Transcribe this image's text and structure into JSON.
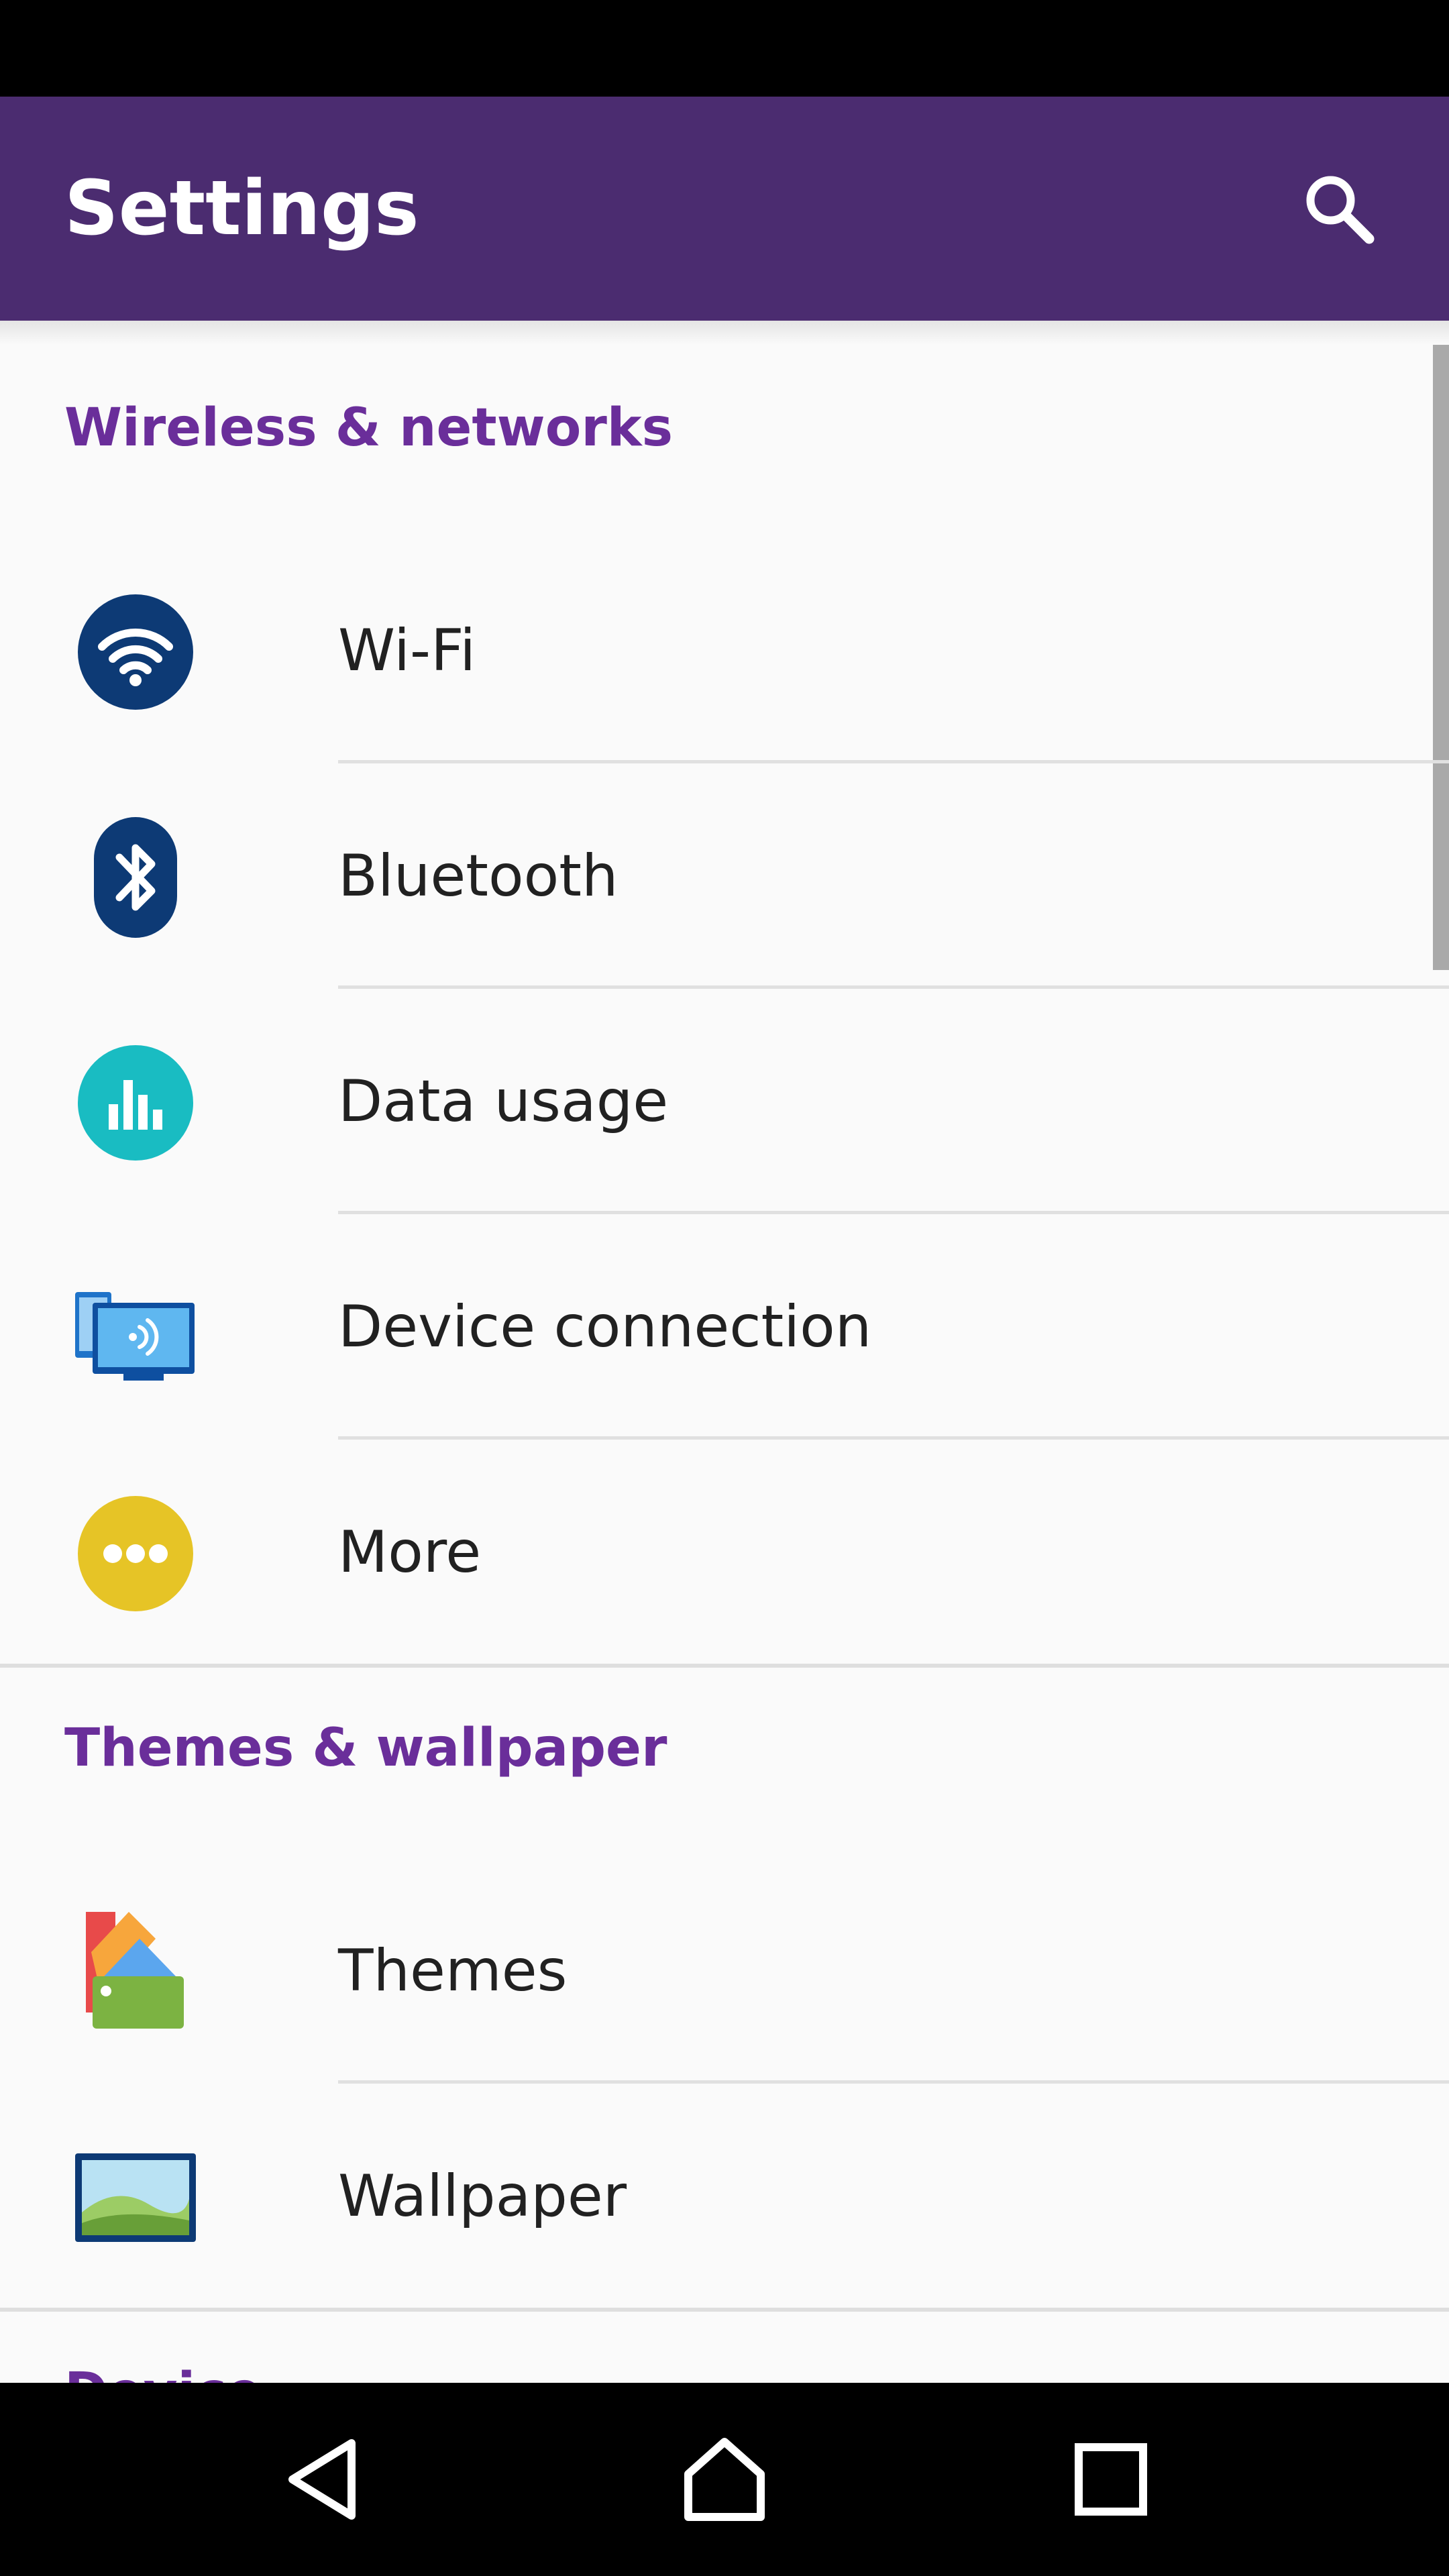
{
  "app_bar": {
    "title": "Settings",
    "search_icon": "search-icon",
    "background": "#4b2c70"
  },
  "accent_color": "#6a2e9a",
  "sections": [
    {
      "header": "Wireless & networks",
      "items": [
        {
          "label": "Wi-Fi",
          "icon": "wifi-icon"
        },
        {
          "label": "Bluetooth",
          "icon": "bluetooth-icon"
        },
        {
          "label": "Data usage",
          "icon": "data-usage-icon"
        },
        {
          "label": "Device connection",
          "icon": "device-connection-icon"
        },
        {
          "label": "More",
          "icon": "more-icon"
        }
      ]
    },
    {
      "header": "Themes & wallpaper",
      "items": [
        {
          "label": "Themes",
          "icon": "themes-icon"
        },
        {
          "label": "Wallpaper",
          "icon": "wallpaper-icon"
        }
      ]
    },
    {
      "header": "Device"
    }
  ],
  "nav_bar": {
    "buttons": [
      {
        "icon": "back-icon"
      },
      {
        "icon": "home-icon"
      },
      {
        "icon": "recents-icon"
      }
    ]
  }
}
